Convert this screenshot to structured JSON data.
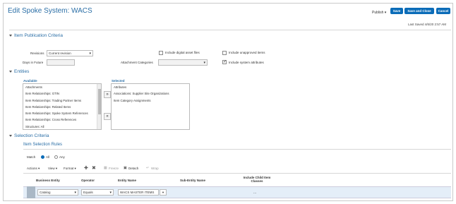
{
  "header": {
    "title": "Edit Spoke System: WACS",
    "publish_label": "Publish ▾",
    "save_label": "Save",
    "save_close_label": "Save and Close",
    "cancel_label": "Cancel",
    "last_saved": "Last Saved   4/6/20 2:57 AM"
  },
  "criteria": {
    "section_title": "Item Publication Criteria",
    "revisions_label": "Revisions",
    "revisions_value": "Current revision",
    "days_label": "Days in Future",
    "attach_label": "Attachment Categories",
    "cb_digital": "Include digital asset files",
    "cb_unapproved": "Include unapproved items",
    "cb_system": "Include system attributes"
  },
  "entities": {
    "section_title": "Entities",
    "available_label": "Available",
    "selected_label": "Selected",
    "available": [
      "Attachments",
      "Item Relationships: GTIN",
      "Item Relationships: Trading Partner Items",
      "Item Relationships: Related Items",
      "Item Relationships: Spoke System References",
      "Item Relationships: Cross References",
      "Structures: All"
    ],
    "selected": [
      "Attributes",
      "Associations: Supplier Site Organizations",
      "Item Category Assignments"
    ]
  },
  "selection": {
    "section_title": "Selection Criteria",
    "rules_title": "Item Selection Rules",
    "match_label": "Match",
    "all_label": "All",
    "any_label": "Any",
    "toolbar": {
      "actions": "Actions ▾",
      "view": "View ▾",
      "format": "Format ▾",
      "freeze": "Freeze",
      "detach": "Detach",
      "wrap": "Wrap"
    },
    "columns": [
      "Business Entity",
      "Operator",
      "Entity Name",
      "Sub-Entity Name",
      "Include Child Item Classes"
    ],
    "row": {
      "business_entity": "Catalog",
      "operator": "Equals",
      "entity_name": "WACS MASTER ITEMS",
      "include_child": "..."
    }
  }
}
